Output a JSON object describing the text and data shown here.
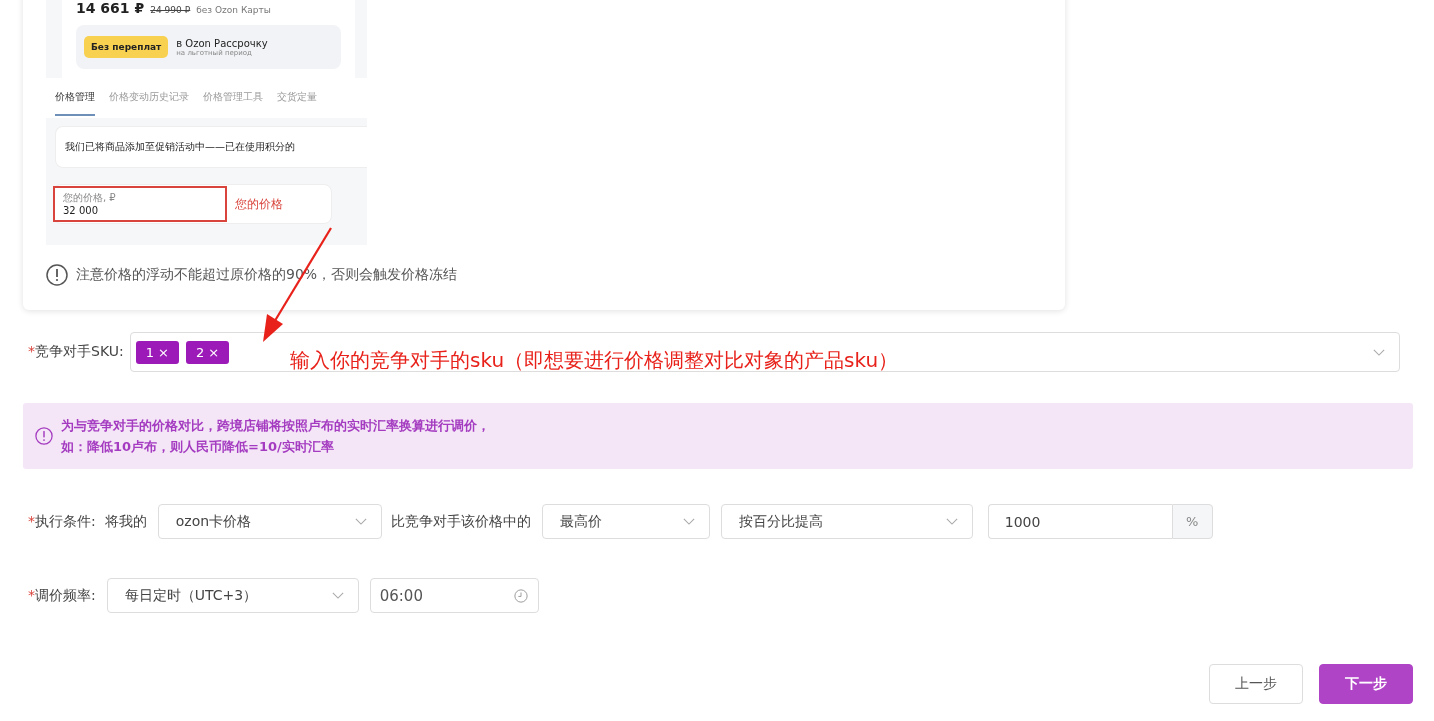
{
  "preview": {
    "price": "14 661 ₽",
    "old_price": "24 990 ₽",
    "price_note": "без Ozon Карты",
    "installment_badge": "Без переплат",
    "installment_title": "в Ozon Рассрочку",
    "installment_sub": "на льготный период",
    "tabs": [
      {
        "label": "价格管理",
        "selected": true
      },
      {
        "label": "价格变动历史记录",
        "selected": false
      },
      {
        "label": "价格管理工具",
        "selected": false
      },
      {
        "label": "交货定量",
        "selected": false
      }
    ],
    "promo_text": "我们已将商品添加至促销活动中——已在使用积分的",
    "price_field": {
      "label": "您的价格, ₽",
      "value": "32 000"
    },
    "price_callout": "您的价格"
  },
  "warning": "注意价格的浮动不能超过原价格的90%，否则会触发价格冻结",
  "sku": {
    "mark": "*",
    "label": "竞争对手SKU:",
    "tags": [
      {
        "label": "1",
        "close": "×"
      },
      {
        "label": "2",
        "close": "×"
      }
    ]
  },
  "annotation": "输入你的竞争对手的sku（即想要进行价格调整对比对象的产品sku）",
  "notice": [
    "为与竞争对手的价格对比，跨境店铺将按照卢布的实时汇率换算进行调价，",
    "如：降低10卢布，则人民币降低=10/实时汇率"
  ],
  "condition": {
    "mark": "*",
    "label": "执行条件:",
    "items": [
      {
        "kind": "text",
        "text": "将我的"
      },
      {
        "kind": "select",
        "value": "ozon卡价格"
      },
      {
        "kind": "text",
        "text": "比竞争对手该价格中的"
      },
      {
        "kind": "select",
        "value": "最高价"
      },
      {
        "kind": "select",
        "value": "按百分比提高"
      },
      {
        "kind": "input",
        "value": "1000",
        "addon": "%"
      }
    ]
  },
  "frequency": {
    "mark": "*",
    "label": "调价频率:",
    "schedule": "每日定时（UTC+3）",
    "time": "06:00"
  },
  "buttons": [
    {
      "label": "上一步",
      "primary": false
    },
    {
      "label": "下一步",
      "primary": true
    }
  ]
}
